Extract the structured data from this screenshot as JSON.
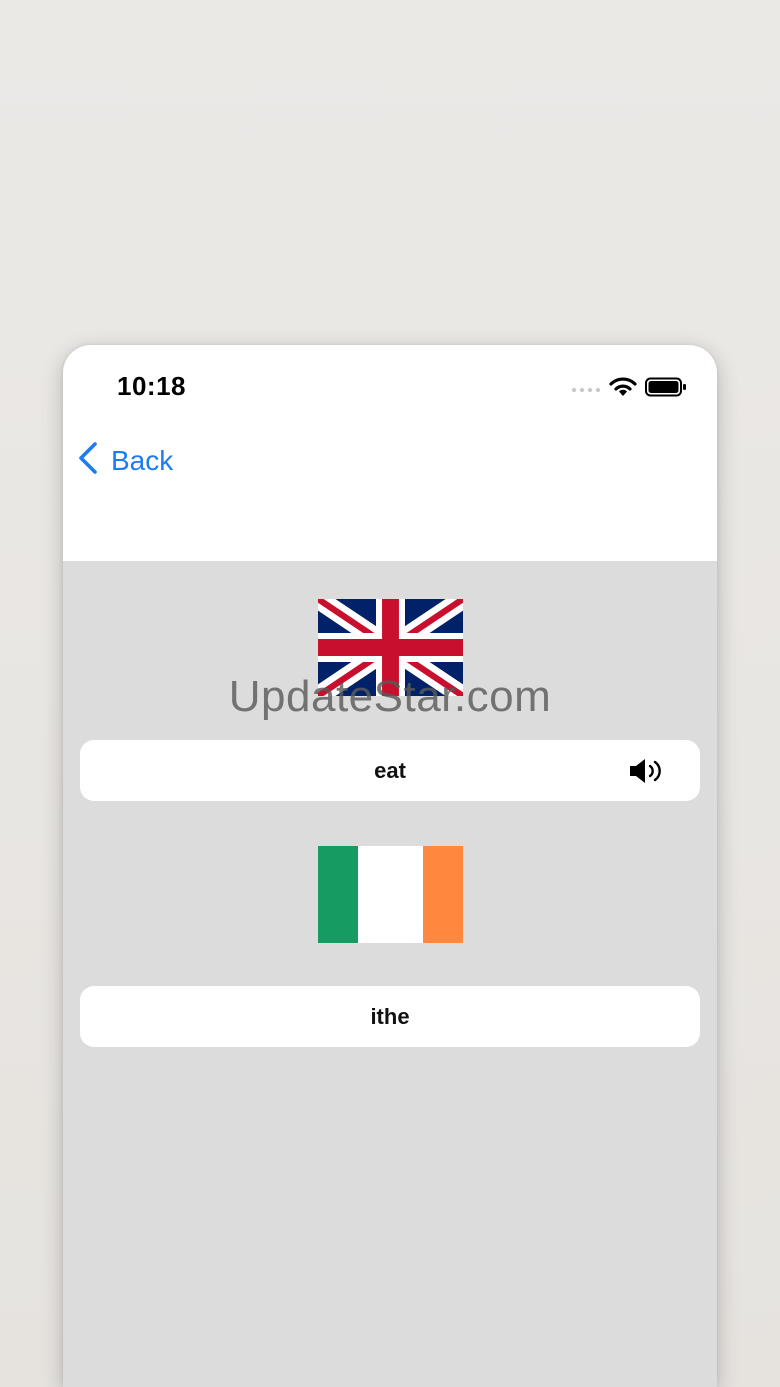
{
  "status_bar": {
    "time": "10:18",
    "icons": [
      "signal-icon",
      "wifi-icon",
      "battery-icon"
    ]
  },
  "nav": {
    "back_label": "Back",
    "back_icon": "chevron-left-icon"
  },
  "source": {
    "flag": "uk-flag",
    "word": "eat",
    "speaker_icon": "speaker-icon"
  },
  "target": {
    "flag": "ireland-flag",
    "word": "ithe"
  },
  "watermark": "UpdateStar.com",
  "colors": {
    "accent": "#1d7cf2",
    "content_bg": "#dcdcdc",
    "ireland_green": "#169b62",
    "ireland_orange": "#ff883e",
    "uk_blue": "#012169",
    "uk_red": "#c8102e"
  }
}
